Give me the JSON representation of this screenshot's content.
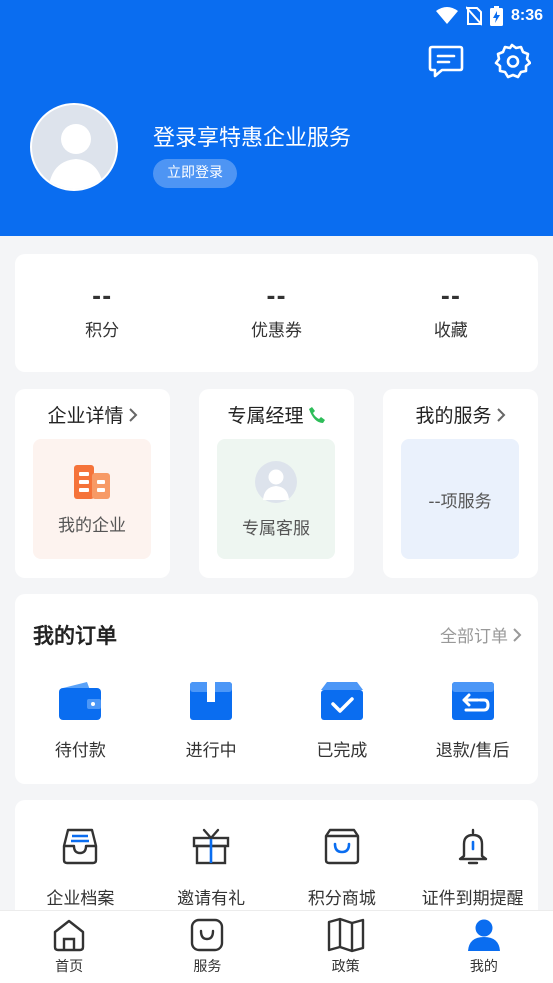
{
  "status": {
    "time": "8:36"
  },
  "header": {
    "title": "登录享特惠企业服务",
    "login_button": "立即登录",
    "icons": [
      "message-icon",
      "settings-icon"
    ]
  },
  "stats": [
    {
      "value": "--",
      "label": "积分"
    },
    {
      "value": "--",
      "label": "优惠券"
    },
    {
      "value": "--",
      "label": "收藏"
    }
  ],
  "cards": {
    "company": {
      "title": "企业详情",
      "inner": "我的企业"
    },
    "manager": {
      "title": "专属经理",
      "inner": "专属客服"
    },
    "services": {
      "title": "我的服务",
      "inner": "--项服务"
    }
  },
  "orders": {
    "title": "我的订单",
    "all": "全部订单",
    "items": [
      {
        "label": "待付款",
        "icon": "wallet-icon"
      },
      {
        "label": "进行中",
        "icon": "box-icon"
      },
      {
        "label": "已完成",
        "icon": "done-icon"
      },
      {
        "label": "退款/售后",
        "icon": "refund-icon"
      }
    ]
  },
  "tools": [
    {
      "label": "企业档案",
      "icon": "archive-icon"
    },
    {
      "label": "邀请有礼",
      "icon": "gift-icon"
    },
    {
      "label": "积分商城",
      "icon": "shopping-bag-icon"
    },
    {
      "label": "证件到期提醒",
      "icon": "bell-icon"
    }
  ],
  "nav": [
    {
      "label": "首页",
      "icon": "home-icon"
    },
    {
      "label": "服务",
      "icon": "service-icon"
    },
    {
      "label": "政策",
      "icon": "book-icon"
    },
    {
      "label": "我的",
      "icon": "user-icon",
      "active": true
    }
  ],
  "colors": {
    "primary": "#0a6df0",
    "orange": "#f5733a",
    "green": "#2ebd59"
  }
}
